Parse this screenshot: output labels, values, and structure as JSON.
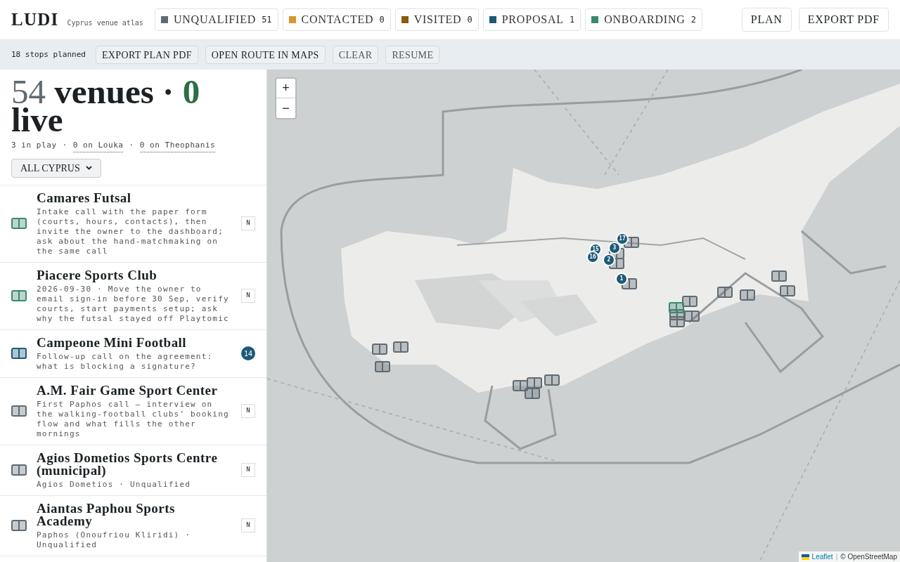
{
  "brand": {
    "name": "LUDI",
    "tagline": "Cyprus venue atlas"
  },
  "status_filters": [
    {
      "label": "UNQUALIFIED",
      "count": "51",
      "color": "#5f6b72"
    },
    {
      "label": "CONTACTED",
      "count": "0",
      "color": "#d9962a"
    },
    {
      "label": "VISITED",
      "count": "0",
      "color": "#8a5a12"
    },
    {
      "label": "PROPOSAL",
      "count": "1",
      "color": "#1d5a78"
    },
    {
      "label": "ONBOARDING",
      "count": "2",
      "color": "#3b8a6e"
    }
  ],
  "header_buttons": [
    "PLAN",
    "EXPORT PDF"
  ],
  "plan_bar": {
    "summary": "18 stops planned",
    "buttons": [
      "EXPORT PLAN PDF",
      "OPEN ROUTE IN MAPS",
      "CLEAR",
      "RESUME"
    ]
  },
  "summary": {
    "venues_count": "54",
    "venues_label": "venues",
    "separator": "·",
    "live_count": "0",
    "live_label": "live",
    "in_play": "3 in play",
    "links": [
      "0 on Louka",
      "0 on Theophanis"
    ]
  },
  "region_select": {
    "value": "ALL CYPRUS"
  },
  "venues": [
    {
      "name": "Camares Futsal",
      "note": "Intake call with the paper form (courts, hours, contacts), then invite the owner to the dashboard; ask about the hand-matchmaking on the same call",
      "color": "#3b8a6e",
      "badge": {
        "kind": "letter",
        "text": "N"
      }
    },
    {
      "name": "Piacere Sports Club",
      "note": "2026-09-30 · Move the owner to email sign-in before 30 Sep, verify courts, start payments setup; ask why the futsal stayed off Playtomic",
      "color": "#3b8a6e",
      "badge": {
        "kind": "letter",
        "text": "N"
      }
    },
    {
      "name": "Campeone Mini Football",
      "note": "Follow-up call on the agreement: what is blocking a signature?",
      "color": "#1d5a78",
      "badge": {
        "kind": "stop",
        "text": "14"
      }
    },
    {
      "name": "A.M. Fair Game Sport Center",
      "note": "First Paphos call — interview on the walking-football clubs' booking flow and what fills the other mornings",
      "color": "#5f6b72",
      "badge": {
        "kind": "letter",
        "text": "N"
      }
    },
    {
      "name": "Agios Dometios Sports Centre (municipal)",
      "note": "Agios Dometios · Unqualified",
      "color": "#5f6b72",
      "badge": {
        "kind": "letter",
        "text": "N"
      }
    },
    {
      "name": "Aiantas Paphou Sports Academy",
      "note": "Paphos (Onoufriou Kliridi) · Unqualified",
      "color": "#5f6b72",
      "badge": {
        "kind": "letter",
        "text": "N"
      }
    }
  ],
  "map": {
    "zoom_buttons": [
      "+",
      "−"
    ],
    "markers": [
      {
        "kind": "venue",
        "color": "#5f6b72"
      },
      {
        "kind": "venue",
        "color": "#5f6b72"
      },
      {
        "kind": "venue",
        "color": "#5f6b72"
      },
      {
        "kind": "venue",
        "color": "#5f6b72"
      },
      {
        "kind": "venue",
        "color": "#5f6b72"
      },
      {
        "kind": "venue",
        "color": "#5f6b72"
      },
      {
        "kind": "venue",
        "color": "#5f6b72"
      },
      {
        "kind": "venue",
        "color": "#5f6b72"
      },
      {
        "kind": "venue",
        "color": "#5f6b72"
      },
      {
        "kind": "venue",
        "color": "#3b8a6e"
      },
      {
        "kind": "venue",
        "color": "#5f6b72"
      },
      {
        "kind": "venue",
        "color": "#5f6b72"
      },
      {
        "kind": "venue",
        "color": "#5f6b72"
      },
      {
        "kind": "venue",
        "color": "#5f6b72"
      },
      {
        "kind": "venue",
        "color": "#5f6b72"
      },
      {
        "kind": "venue",
        "color": "#5f6b72"
      },
      {
        "kind": "venue",
        "color": "#5f6b72"
      },
      {
        "kind": "venue",
        "color": "#5f6b72"
      },
      {
        "kind": "venue",
        "color": "#5f6b72"
      },
      {
        "kind": "venue",
        "color": "#5f6b72"
      },
      {
        "kind": "stop",
        "text": "17"
      },
      {
        "kind": "stop",
        "text": "15"
      },
      {
        "kind": "stop",
        "text": "3"
      },
      {
        "kind": "stop",
        "text": "16"
      },
      {
        "kind": "stop",
        "text": "2"
      },
      {
        "kind": "stop",
        "text": "1"
      }
    ],
    "attribution": {
      "library": "Leaflet",
      "separator": "|",
      "source": "© OpenStreetMap"
    }
  }
}
